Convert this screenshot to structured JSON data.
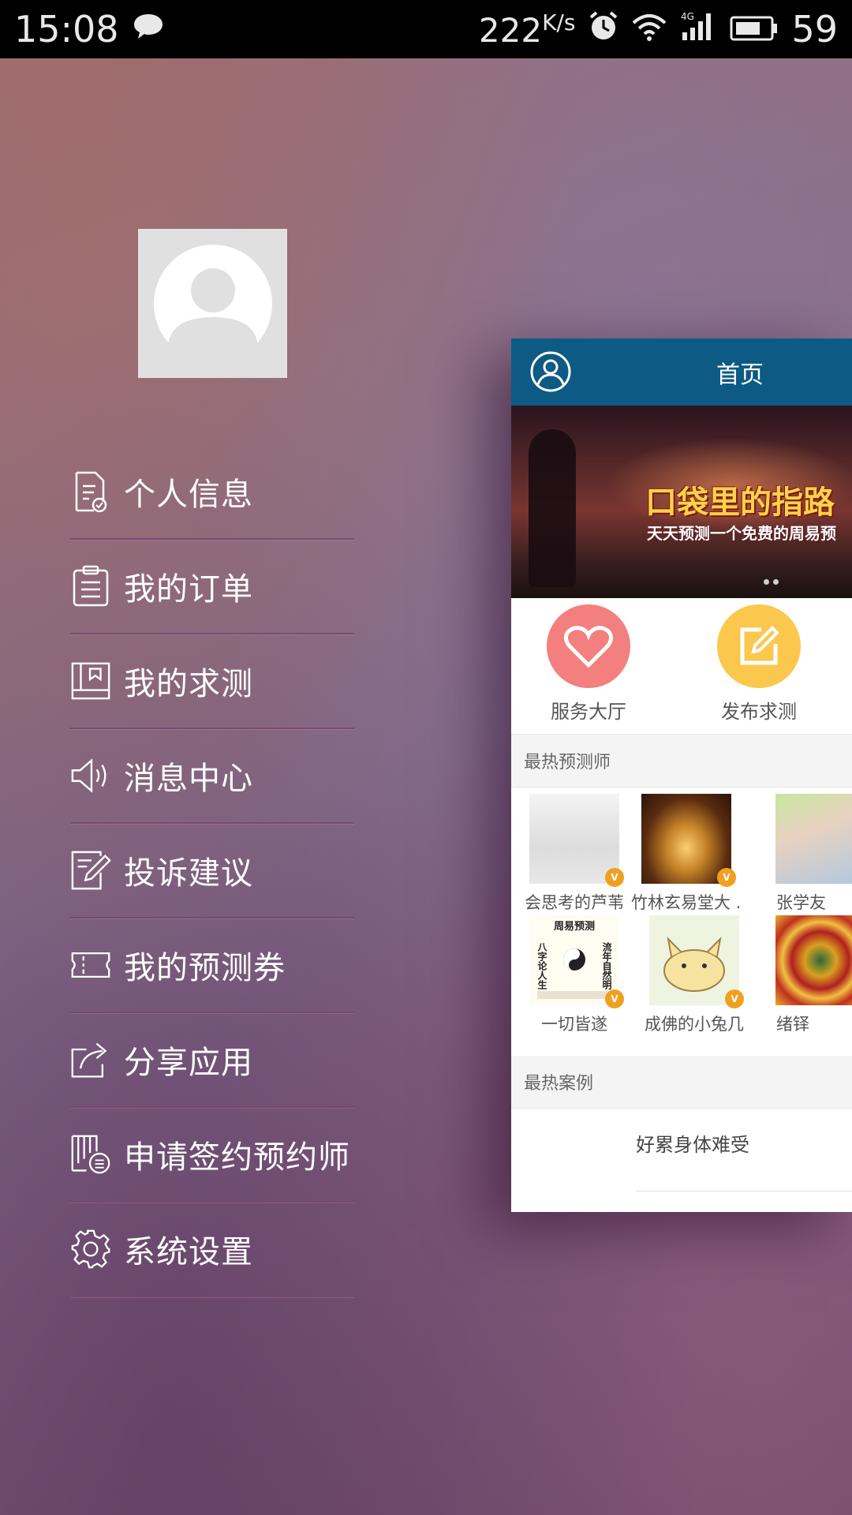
{
  "status_bar": {
    "time": "15:08",
    "net_speed": "222",
    "net_unit": "K/s",
    "battery": "59",
    "icons": [
      "message-icon",
      "alarm-icon",
      "wifi-icon",
      "signal-4g-icon",
      "battery-icon"
    ]
  },
  "drawer": {
    "avatar_icon": "default-user-avatar",
    "menu": [
      {
        "label": "个人信息",
        "icon": "profile-document-icon"
      },
      {
        "label": "我的订单",
        "icon": "clipboard-icon"
      },
      {
        "label": "我的求测",
        "icon": "book-icon"
      },
      {
        "label": "消息中心",
        "icon": "speaker-icon"
      },
      {
        "label": "投诉建议",
        "icon": "edit-note-icon"
      },
      {
        "label": "我的预测券",
        "icon": "ticket-icon"
      },
      {
        "label": "分享应用",
        "icon": "share-icon"
      },
      {
        "label": "申请签约预约师",
        "icon": "apply-list-icon"
      },
      {
        "label": "系统设置",
        "icon": "gear-icon"
      }
    ]
  },
  "preview": {
    "header_title": "首页",
    "banner_title": "口袋里的指路",
    "banner_subtitle": "天天预测一个免费的周易预",
    "actions": [
      {
        "label": "服务大厅",
        "color": "#f47f7f",
        "icon": "heart-icon"
      },
      {
        "label": "发布求测",
        "color": "#fbc74d",
        "icon": "edit-icon"
      }
    ],
    "hot_experts_title": "最热预测师",
    "experts": [
      {
        "name": "会思考的芦苇"
      },
      {
        "name": "竹林玄易堂大 .."
      },
      {
        "name": "张学友"
      },
      {
        "name": "一切皆遂"
      },
      {
        "name": "成佛的小兔几"
      },
      {
        "name": "绪铎"
      }
    ],
    "expert_badge": "V",
    "expert_image_text": {
      "top": "周易预测",
      "left": "八字论人生",
      "right": "流年自然明"
    },
    "hot_cases_title": "最热案例",
    "cases": [
      {
        "text": "好累身体难受"
      }
    ]
  }
}
